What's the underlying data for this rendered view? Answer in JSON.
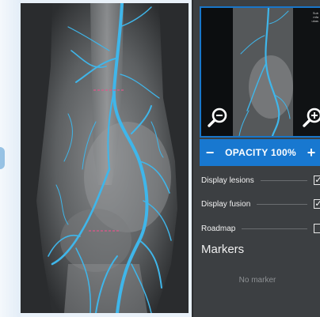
{
  "viewer": {
    "image_name": "angiography-leg-xray"
  },
  "thumbnail": {
    "caption_lines": [
      "Sub",
      "mfa",
      "ukas"
    ],
    "zoom_out_icon": "magnifier-minus-icon",
    "zoom_in_icon": "magnifier-plus-icon"
  },
  "opacity": {
    "decrease_label": "−",
    "label": "OPACITY 100%",
    "increase_label": "+",
    "value_percent": 100
  },
  "options": [
    {
      "label": "Display lesions",
      "checked": true
    },
    {
      "label": "Display fusion",
      "checked": true
    },
    {
      "label": "Roadmap",
      "checked": false
    }
  ],
  "markers": {
    "title": "Markers",
    "empty_text": "No marker"
  },
  "colors": {
    "accent": "#1878d0",
    "vessel": "#3fb6ea",
    "lesion_marker": "#e0568a",
    "panel_bg": "#3c3f42"
  }
}
